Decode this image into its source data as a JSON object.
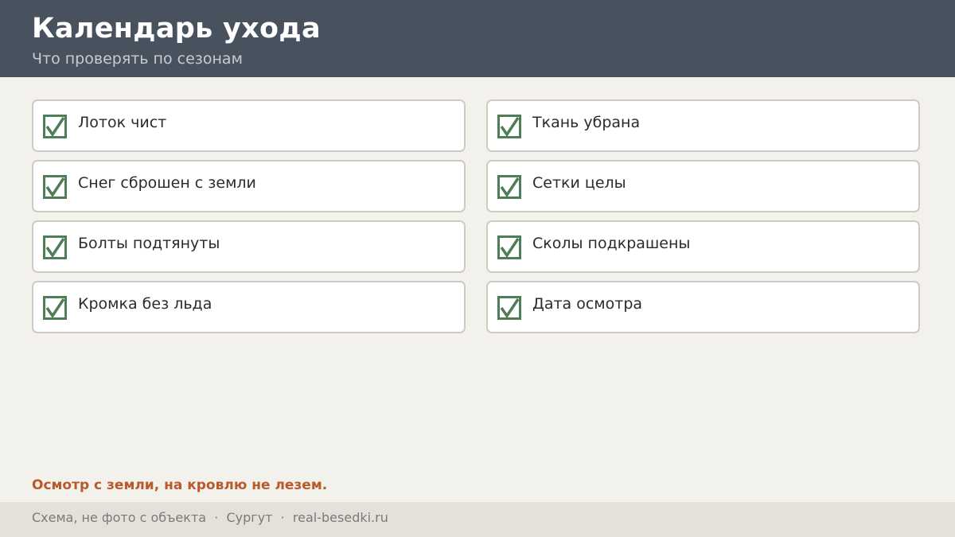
{
  "header": {
    "title": "Календарь ухода",
    "subtitle": "Что проверять по сезонам"
  },
  "checklist": {
    "items": [
      {
        "label": "Лоток чист",
        "checked": true
      },
      {
        "label": "Ткань убрана",
        "checked": true
      },
      {
        "label": "Снег сброшен с земли",
        "checked": true
      },
      {
        "label": "Сетки целы",
        "checked": true
      },
      {
        "label": "Болты подтянуты",
        "checked": true
      },
      {
        "label": "Сколы подкрашены",
        "checked": true
      },
      {
        "label": "Кромка без льда",
        "checked": true
      },
      {
        "label": "Дата осмотра",
        "checked": true
      }
    ]
  },
  "note": "Осмотр с земли, на кровлю не лезем.",
  "footer": {
    "text": "Схема, не фото с объекта  ·  Сургут  ·  real-besedki.ru"
  },
  "colors": {
    "header_bg": "#48515e",
    "check_green": "#4e7d57",
    "note_accent": "#b85a2a"
  },
  "icons": {
    "checkbox": "checked-checkbox-icon"
  }
}
